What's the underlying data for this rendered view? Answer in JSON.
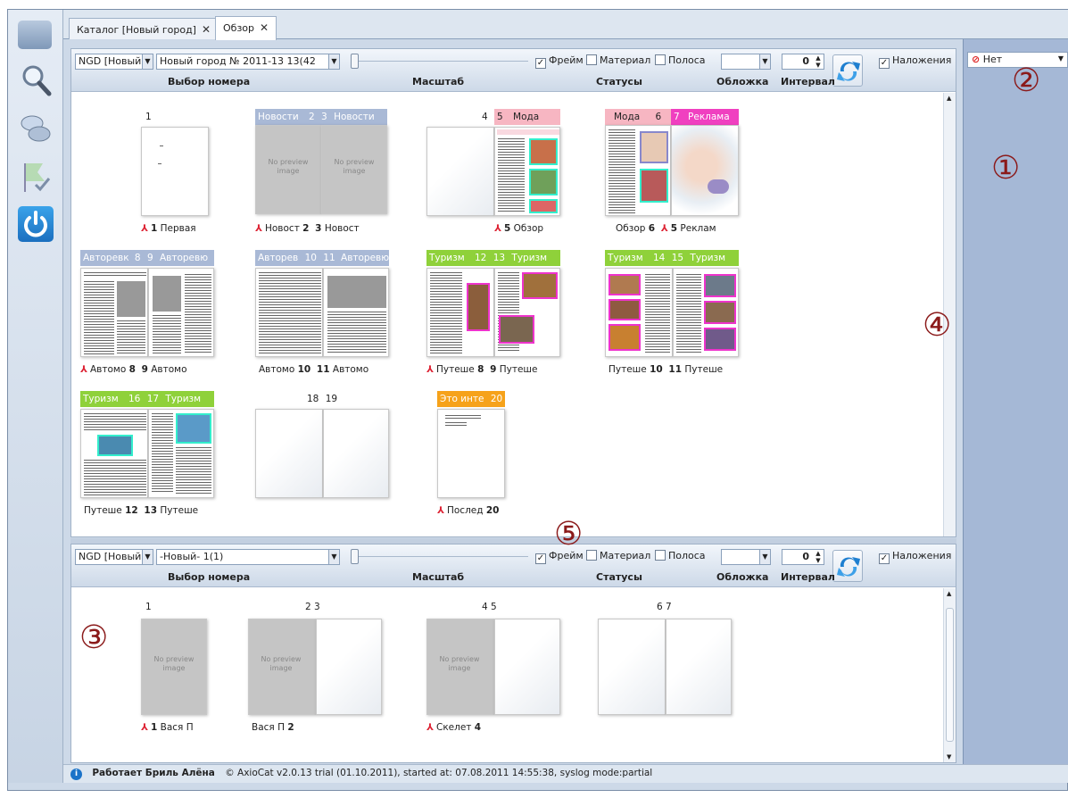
{
  "tabs": [
    {
      "label": "Каталог [Новый город]"
    },
    {
      "label": "Обзор"
    }
  ],
  "top_panel": {
    "edition_select": "NGD [Новый г",
    "issue_select": "Новый город № 2011-13 13(42",
    "chk_frame": "Фрейм",
    "chk_material": "Материал",
    "chk_strip": "Полоса",
    "interval_value": "0",
    "chk_overlays": "Наложения",
    "hdr_issue": "Выбор номера",
    "hdr_scale": "Масштаб",
    "hdr_statuses": "Статусы",
    "hdr_cover": "Обложка",
    "hdr_interval": "Интервал",
    "spreads": [
      {
        "nums": "1",
        "caption_num": "1",
        "caption_name": "Первая"
      },
      {
        "section_left": "Новости",
        "num_left": "2",
        "num_right": "3",
        "section_right": "Новости",
        "cap_left_name": "Новост",
        "cap_left_num": "2",
        "cap_right_num": "3",
        "cap_right_name": "Новост"
      },
      {
        "num_left": "4",
        "num_right": "5",
        "section_right": "Мода",
        "cap_right_num": "5",
        "cap_right_name": "Обзор"
      },
      {
        "section_left": "Мода",
        "num_left": "6",
        "num_right": "7",
        "section_right": "Реклама",
        "cap_left_name": "Обзор",
        "cap_left_num": "6",
        "cap_right_num": "5",
        "cap_right_name": "Реклам"
      },
      {
        "section_left": "Авторевк",
        "num_left": "8",
        "num_right": "9",
        "section_right": "Авторевю",
        "cap_left_name": "Автомо",
        "cap_left_num": "8",
        "cap_right_num": "9",
        "cap_right_name": "Автомо"
      },
      {
        "section_left": "Авторев",
        "num_left": "10",
        "num_right": "11",
        "section_right": "Авторевю",
        "cap_left_name": "Автомо",
        "cap_left_num": "10",
        "cap_right_num": "11",
        "cap_right_name": "Автомо"
      },
      {
        "section_left": "Туризм",
        "num_left": "12",
        "num_right": "13",
        "section_right": "Туризм",
        "cap_left_name": "Путеше",
        "cap_left_num": "8",
        "cap_right_num": "9",
        "cap_right_name": "Путеше"
      },
      {
        "section_left": "Туризм",
        "num_left": "14",
        "num_right": "15",
        "section_right": "Туризм",
        "cap_left_name": "Путеше",
        "cap_left_num": "10",
        "cap_right_num": "11",
        "cap_right_name": "Путеше"
      },
      {
        "section_left": "Туризм",
        "num_left": "16",
        "num_right": "17",
        "section_right": "Туризм",
        "cap_left_name": "Путеше",
        "cap_left_num": "12",
        "cap_right_num": "13",
        "cap_right_name": "Путеше"
      },
      {
        "num_left": "18",
        "num_right": "19"
      },
      {
        "section_left": "Это инте",
        "num_left": "20",
        "cap_left_name": "Послед",
        "cap_left_num": "20"
      }
    ],
    "no_preview": "No preview image"
  },
  "bottom_panel": {
    "edition_select": "NGD [Новый г",
    "issue_select": "-Новый- 1(1)",
    "chk_frame": "Фрейм",
    "chk_material": "Материал",
    "chk_strip": "Полоса",
    "interval_value": "0",
    "chk_overlays": "Наложения",
    "hdr_issue": "Выбор номера",
    "hdr_scale": "Масштаб",
    "hdr_statuses": "Статусы",
    "hdr_cover": "Обложка",
    "hdr_interval": "Интервал",
    "p1_num": "1",
    "p1_cap_num": "1",
    "p1_cap_name": "Вася П",
    "p23_nums": "2  3",
    "p23_cap_name": "Вася П",
    "p23_cap_num": "2",
    "p45_nums": "4  5",
    "p45_cap_name": "Скелет",
    "p45_cap_num": "4",
    "p67_nums": "6  7"
  },
  "right_panel": {
    "select": "Нет"
  },
  "annotations": {
    "c1": "①",
    "c2": "②",
    "c3": "③",
    "c4": "④",
    "c5": "⑤"
  },
  "status": {
    "user": "Работает Бриль Алёна",
    "info": "© AxioCat v2.0.13 trial (01.10.2011), started at: 07.08.2011 14:55:38, syslog mode:partial"
  },
  "colors": {
    "news": "#a9b9d6",
    "fashion": "#f7b6c2",
    "ad": "#f040c0",
    "auto": "#a9b9d6",
    "tourism": "#8fd13a",
    "interesting": "#f6a21a"
  }
}
